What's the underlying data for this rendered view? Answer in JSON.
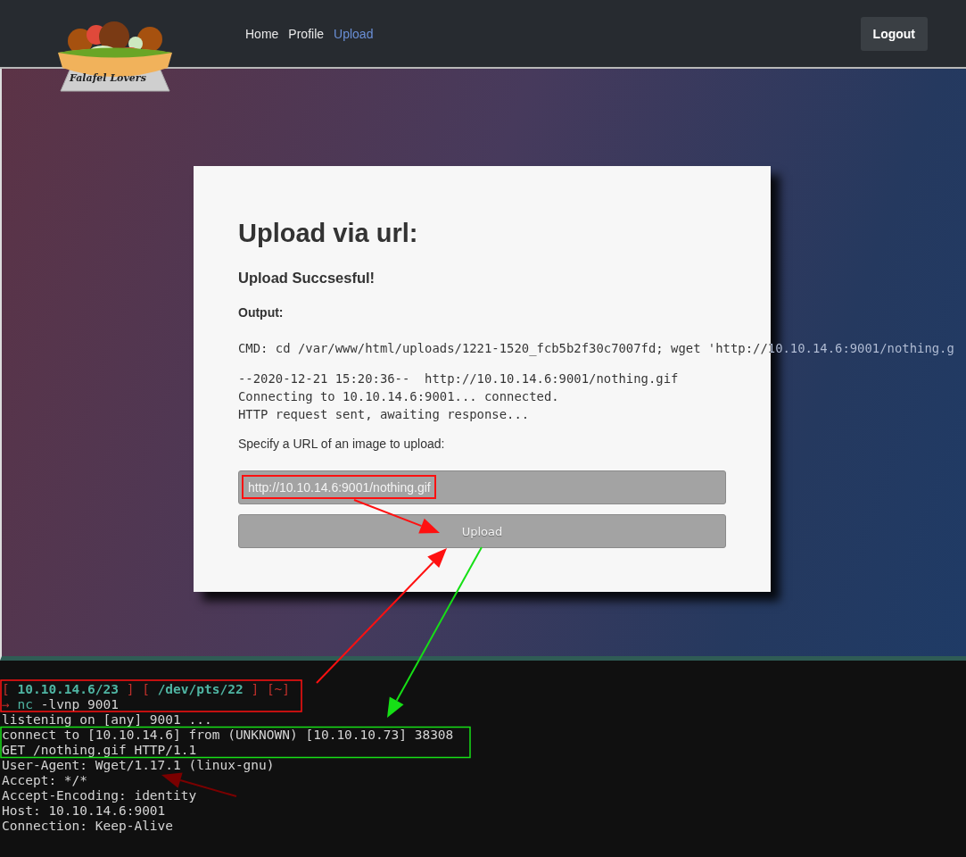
{
  "navbar": {
    "logo_text": "Falafel Lovers",
    "links": [
      {
        "label": "Home",
        "selected": false
      },
      {
        "label": "Profile",
        "selected": false
      },
      {
        "label": "Upload",
        "selected": true
      }
    ],
    "logout": "Logout"
  },
  "card": {
    "title": "Upload via url:",
    "status": "Upload Succsesful!",
    "output_label": "Output:",
    "output_lines": [
      "CMD: cd /var/www/html/uploads/1221-1520_fcb5b2f30c7007fd; wget 'http://10.10.14.6:9001/nothing.g",
      "--2020-12-21 15:20:36--  http://10.10.14.6:9001/nothing.gif",
      "Connecting to 10.10.14.6:9001... connected.",
      "HTTP request sent, awaiting response..."
    ],
    "prompt": "Specify a URL of an image to upload:",
    "url_value": "http://10.10.14.6:9001/nothing.gif",
    "upload_button": "Upload"
  },
  "terminal": {
    "prompt": [
      {
        "text": "[",
        "kind": "punct"
      },
      {
        "text": "10.10.14.6/23",
        "kind": "value"
      },
      {
        "text": "]",
        "kind": "punct"
      },
      {
        "text": "[",
        "kind": "punct"
      },
      {
        "text": "/dev/pts/22",
        "kind": "value"
      },
      {
        "text": "]",
        "kind": "punct"
      },
      {
        "text": "[~]",
        "kind": "punct"
      }
    ],
    "command": [
      {
        "text": "→",
        "kind": "punct"
      },
      {
        "text": "nc",
        "kind": "command"
      },
      {
        "text": "-lvnp 9001",
        "kind": "plain"
      }
    ],
    "lines": [
      "listening on [any] 9001 ...",
      "connect to [10.10.14.6] from (UNKNOWN) [10.10.10.73] 38308",
      "GET /nothing.gif HTTP/1.1",
      "User-Agent: Wget/1.17.1 (linux-gnu)",
      "Accept: */*",
      "Accept-Encoding: identity",
      "Host: 10.10.14.6:9001",
      "Connection: Keep-Alive"
    ]
  }
}
